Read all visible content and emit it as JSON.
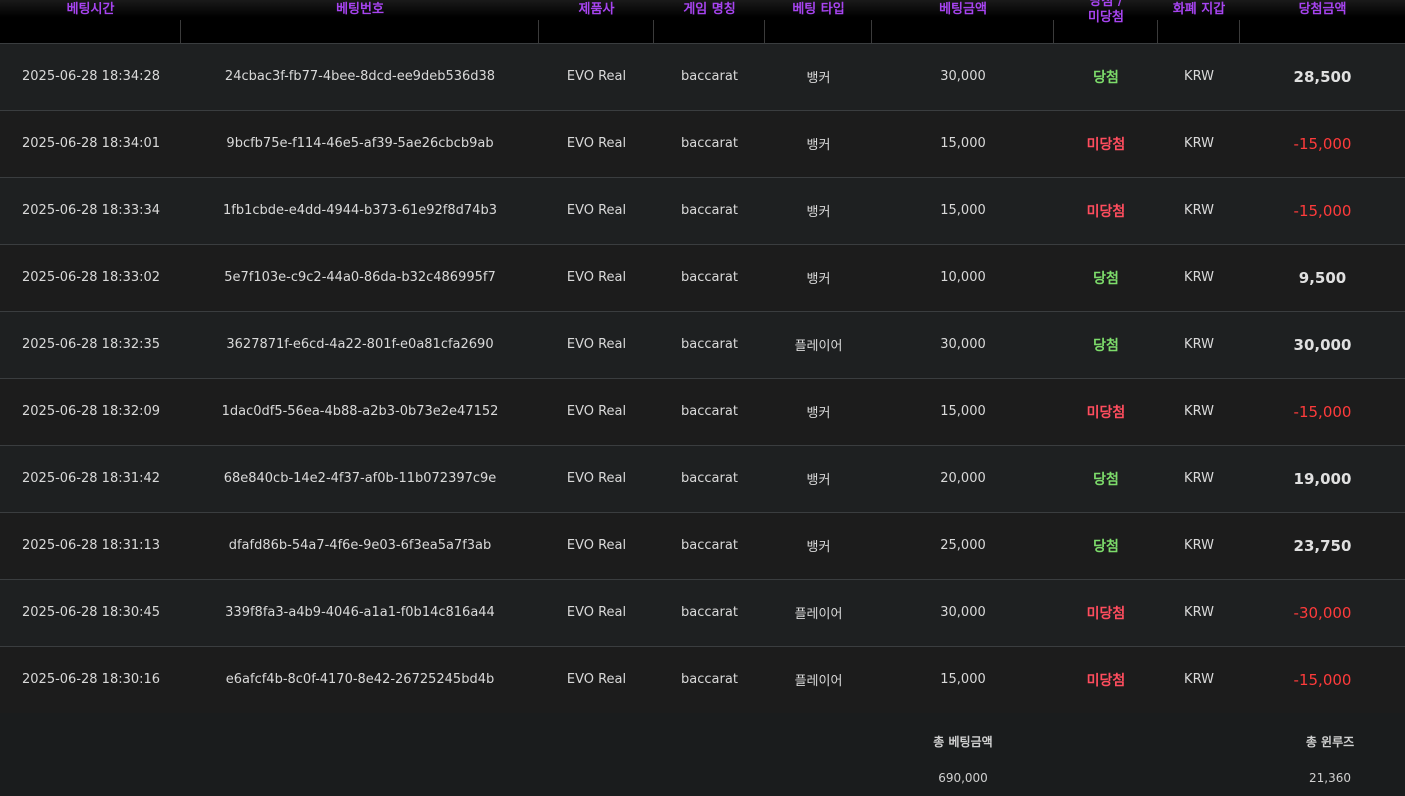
{
  "table": {
    "headers": [
      {
        "label": "베팅시간"
      },
      {
        "label": "베팅번호"
      },
      {
        "label": "제품사"
      },
      {
        "label": "게임 명칭"
      },
      {
        "label": "베팅 타입"
      },
      {
        "label": "베팅금액"
      },
      {
        "label_line1": "당첨 /",
        "label_line2": "미당첨"
      },
      {
        "label": "화폐 지갑"
      },
      {
        "label": "당첨금액"
      }
    ],
    "rows": [
      {
        "time": "2025-06-28 18:34:28",
        "id": "24cbac3f-fb77-4bee-8dcd-ee9deb536d38",
        "vendor": "EVO Real",
        "game": "baccarat",
        "bet_type": "뱅커",
        "amount": "30,000",
        "result": "당첨",
        "result_status": "win",
        "wallet": "KRW",
        "payout": "28,500"
      },
      {
        "time": "2025-06-28 18:34:01",
        "id": "9bcfb75e-f114-46e5-af39-5ae26cbcb9ab",
        "vendor": "EVO Real",
        "game": "baccarat",
        "bet_type": "뱅커",
        "amount": "15,000",
        "result": "미당첨",
        "result_status": "lose",
        "wallet": "KRW",
        "payout": "-15,000"
      },
      {
        "time": "2025-06-28 18:33:34",
        "id": "1fb1cbde-e4dd-4944-b373-61e92f8d74b3",
        "vendor": "EVO Real",
        "game": "baccarat",
        "bet_type": "뱅커",
        "amount": "15,000",
        "result": "미당첨",
        "result_status": "lose",
        "wallet": "KRW",
        "payout": "-15,000"
      },
      {
        "time": "2025-06-28 18:33:02",
        "id": "5e7f103e-c9c2-44a0-86da-b32c486995f7",
        "vendor": "EVO Real",
        "game": "baccarat",
        "bet_type": "뱅커",
        "amount": "10,000",
        "result": "당첨",
        "result_status": "win",
        "wallet": "KRW",
        "payout": "9,500"
      },
      {
        "time": "2025-06-28 18:32:35",
        "id": "3627871f-e6cd-4a22-801f-e0a81cfa2690",
        "vendor": "EVO Real",
        "game": "baccarat",
        "bet_type": "플레이어",
        "amount": "30,000",
        "result": "당첨",
        "result_status": "win",
        "wallet": "KRW",
        "payout": "30,000"
      },
      {
        "time": "2025-06-28 18:32:09",
        "id": "1dac0df5-56ea-4b88-a2b3-0b73e2e47152",
        "vendor": "EVO Real",
        "game": "baccarat",
        "bet_type": "뱅커",
        "amount": "15,000",
        "result": "미당첨",
        "result_status": "lose",
        "wallet": "KRW",
        "payout": "-15,000"
      },
      {
        "time": "2025-06-28 18:31:42",
        "id": "68e840cb-14e2-4f37-af0b-11b072397c9e",
        "vendor": "EVO Real",
        "game": "baccarat",
        "bet_type": "뱅커",
        "amount": "20,000",
        "result": "당첨",
        "result_status": "win",
        "wallet": "KRW",
        "payout": "19,000"
      },
      {
        "time": "2025-06-28 18:31:13",
        "id": "dfafd86b-54a7-4f6e-9e03-6f3ea5a7f3ab",
        "vendor": "EVO Real",
        "game": "baccarat",
        "bet_type": "뱅커",
        "amount": "25,000",
        "result": "당첨",
        "result_status": "win",
        "wallet": "KRW",
        "payout": "23,750"
      },
      {
        "time": "2025-06-28 18:30:45",
        "id": "339f8fa3-a4b9-4046-a1a1-f0b14c816a44",
        "vendor": "EVO Real",
        "game": "baccarat",
        "bet_type": "플레이어",
        "amount": "30,000",
        "result": "미당첨",
        "result_status": "lose",
        "wallet": "KRW",
        "payout": "-30,000"
      },
      {
        "time": "2025-06-28 18:30:16",
        "id": "e6afcf4b-8c0f-4170-8e42-26725245bd4b",
        "vendor": "EVO Real",
        "game": "baccarat",
        "bet_type": "플레이어",
        "amount": "15,000",
        "result": "미당첨",
        "result_status": "lose",
        "wallet": "KRW",
        "payout": "-15,000"
      }
    ]
  },
  "summary": {
    "total_bet_label": "총 베팅금액",
    "total_bet_value": "690,000",
    "total_winloss_label": "총 윈루즈",
    "total_winloss_value": "21,360"
  },
  "colors": {
    "header_text": "#a744f0",
    "win": "#7ddc6b",
    "lose": "#ff4d5e",
    "negative_payout": "#ff3b3b",
    "row_bg": "#1e2021",
    "header_bg": "#000000"
  }
}
